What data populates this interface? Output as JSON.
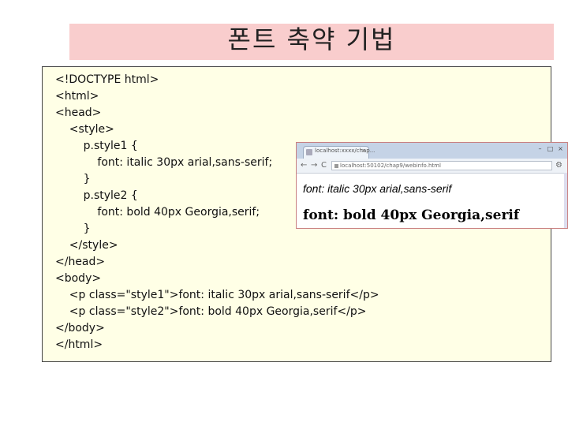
{
  "slide": {
    "title": "폰트 축약 기법"
  },
  "code": {
    "lines": [
      "<!DOCTYPE html>",
      "<html>",
      "<head>",
      "    <style>",
      "        p.style1 {",
      "            font: italic 30px arial,sans-serif;",
      "        }",
      "        p.style2 {",
      "            font: bold 40px Georgia,serif;",
      "        }",
      "    </style>",
      "</head>",
      "<body>",
      "    <p class=\"style1\">font: italic 30px arial,sans-serif</p>",
      "    <p class=\"style2\">font: bold 40px Georgia,serif</p>",
      "</body>",
      "</html>"
    ]
  },
  "browser": {
    "tab_title": "localhost:xxxx/chap...",
    "tab_close": "×",
    "address": "localhost:50102/chap9/webinfo.html",
    "minimize": "–",
    "maximize": "□",
    "close": "×",
    "back": "←",
    "forward": "→",
    "reload": "C",
    "wrench": "⚙",
    "line1": "font: italic 30px arial,sans-serif",
    "line2": "font: bold 40px Georgia,serif"
  }
}
